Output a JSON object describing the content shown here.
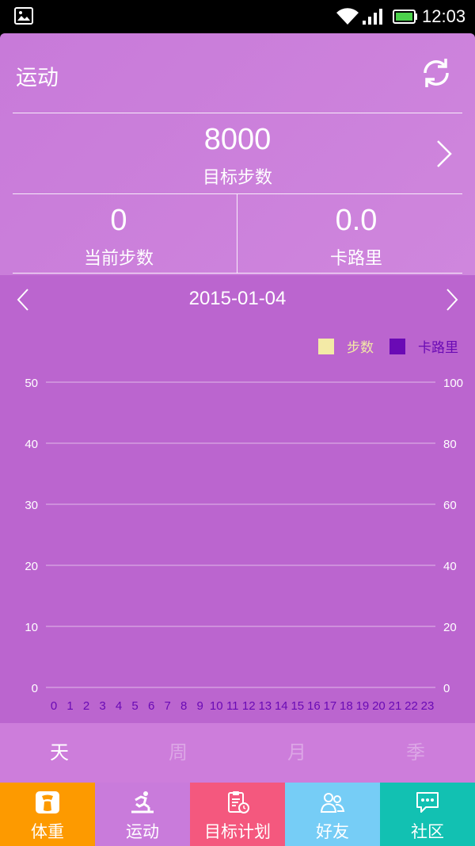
{
  "status_bar": {
    "time": "12:03"
  },
  "header": {
    "title": "运动",
    "goal": {
      "value": "8000",
      "label": "目标步数"
    },
    "current_steps": {
      "value": "0",
      "label": "当前步数"
    },
    "calories": {
      "value": "0.0",
      "label": "卡路里"
    }
  },
  "date_nav": {
    "date": "2015-01-04"
  },
  "chart_data": {
    "type": "bar",
    "categories": [
      "0",
      "1",
      "2",
      "3",
      "4",
      "5",
      "6",
      "7",
      "8",
      "9",
      "10",
      "11",
      "12",
      "13",
      "14",
      "15",
      "16",
      "17",
      "18",
      "19",
      "20",
      "21",
      "22",
      "23"
    ],
    "series": [
      {
        "name": "步数",
        "values": [
          0,
          0,
          0,
          0,
          0,
          0,
          0,
          0,
          0,
          0,
          0,
          0,
          0,
          0,
          0,
          0,
          0,
          0,
          0,
          0,
          0,
          0,
          0,
          0
        ],
        "color": "#f3eaa6",
        "axis": "left"
      },
      {
        "name": "卡路里",
        "values": [
          0,
          0,
          0,
          0,
          0,
          0,
          0,
          0,
          0,
          0,
          0,
          0,
          0,
          0,
          0,
          0,
          0,
          0,
          0,
          0,
          0,
          0,
          0,
          0
        ],
        "color": "#6a0ab5",
        "axis": "right"
      }
    ],
    "y_left": {
      "min": 0,
      "max": 50,
      "ticks": [
        "0",
        "10",
        "20",
        "30",
        "40",
        "50"
      ]
    },
    "y_right": {
      "min": 0,
      "max": 100,
      "ticks": [
        "0",
        "20",
        "40",
        "60",
        "80",
        "100"
      ]
    },
    "grid": true,
    "legend_position": "top-right",
    "tick_label_color": "#6a0ab5"
  },
  "period_tabs": [
    {
      "label": "天",
      "active": true
    },
    {
      "label": "周",
      "active": false
    },
    {
      "label": "月",
      "active": false
    },
    {
      "label": "季",
      "active": false
    }
  ],
  "bottom_nav": [
    {
      "label": "体重",
      "color": "#fd9a00",
      "icon": "weight-icon"
    },
    {
      "label": "运动",
      "color": "#c97bdb",
      "icon": "running-icon"
    },
    {
      "label": "目标计划",
      "color": "#f4587e",
      "icon": "clipboard-clock-icon"
    },
    {
      "label": "好友",
      "color": "#76cdf6",
      "icon": "friends-icon"
    },
    {
      "label": "社区",
      "color": "#12c1b2",
      "icon": "chat-icon"
    }
  ]
}
